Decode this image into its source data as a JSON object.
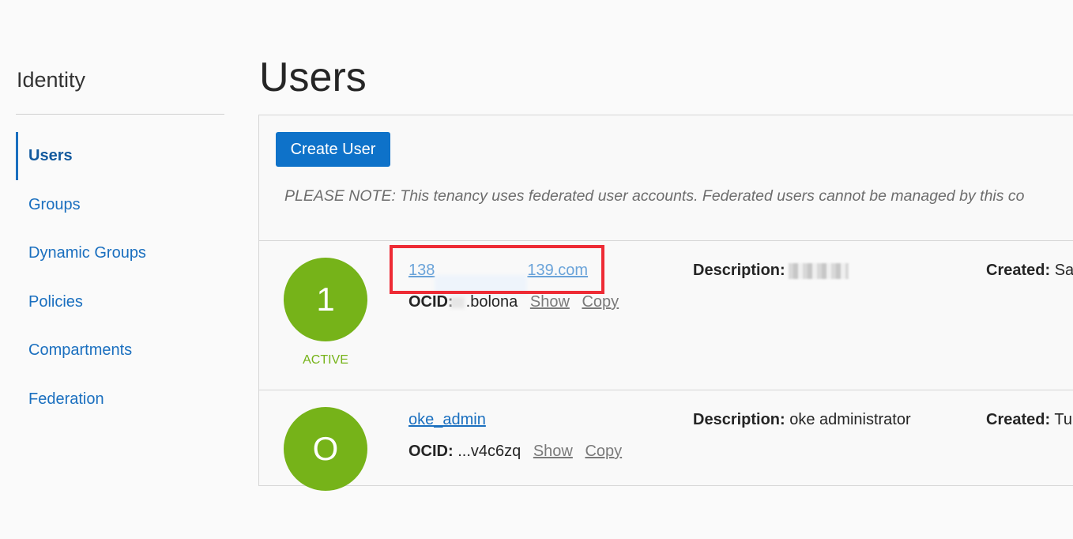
{
  "sidebar": {
    "title": "Identity",
    "items": [
      {
        "label": "Users",
        "active": true
      },
      {
        "label": "Groups"
      },
      {
        "label": "Dynamic Groups"
      },
      {
        "label": "Policies"
      },
      {
        "label": "Compartments"
      },
      {
        "label": "Federation"
      }
    ]
  },
  "page": {
    "title": "Users"
  },
  "toolbar": {
    "create_label": "Create User"
  },
  "note": "PLEASE NOTE: This tenancy uses federated user accounts. Federated users cannot be managed by this co",
  "users": [
    {
      "avatar": "1",
      "status": "ACTIVE",
      "name_prefix": "138",
      "name_suffix": "139.com",
      "ocid_label": "OCID:",
      "ocid_value": ".bolona",
      "show": "Show",
      "copy": "Copy",
      "description_label": "Description:",
      "description_value": "",
      "created_label": "Created:",
      "created_value": "Sa"
    },
    {
      "avatar": "O",
      "name": "oke_admin",
      "ocid_label": "OCID:",
      "ocid_value": "...v4c6zq",
      "show": "Show",
      "copy": "Copy",
      "description_label": "Description:",
      "description_value": "oke administrator",
      "created_label": "Created:",
      "created_value": "Tu"
    }
  ],
  "colors": {
    "accent": "#0e72c9",
    "link": "#1a6fbf",
    "active_green": "#76b319",
    "highlight": "#ee2b35"
  }
}
